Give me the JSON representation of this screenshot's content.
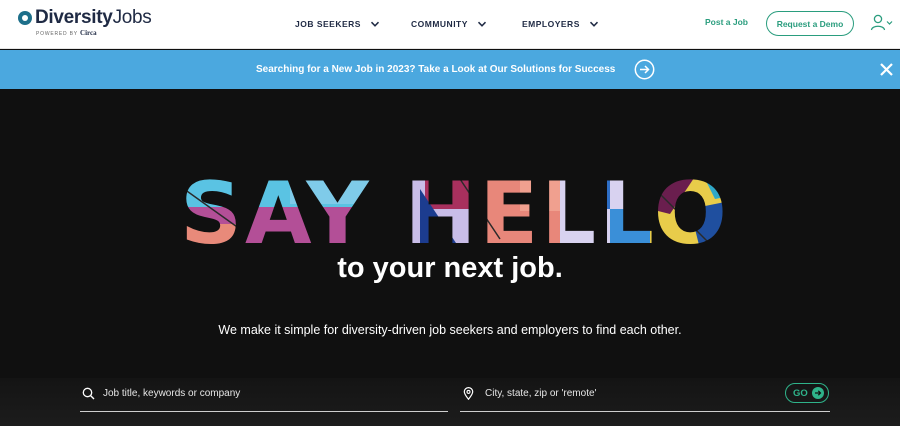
{
  "brand": {
    "name_bold": "Diversity",
    "name_light": "Jobs",
    "powered_by": "POWERED BY",
    "parent": "Circa"
  },
  "nav": {
    "items": [
      {
        "label": "JOB SEEKERS",
        "icon": "chevron-down-icon"
      },
      {
        "label": "COMMUNITY",
        "icon": "chevron-down-icon"
      },
      {
        "label": "EMPLOYERS",
        "icon": "chevron-down-icon"
      }
    ],
    "post_job": "Post a Job",
    "request_demo": "Request a Demo",
    "user_icon": "user-icon"
  },
  "banner": {
    "text": "Searching for a New Job in 2023? Take a Look at Our Solutions for Success",
    "arrow_icon": "arrow-right-circle-icon",
    "close_icon": "close-icon",
    "color": "#4ba8df"
  },
  "hero": {
    "headline": "SAY HELLO",
    "subheadline": "to your next job.",
    "tagline": "We make it simple for diversity-driven job seekers and employers to find each other."
  },
  "search": {
    "keyword_placeholder": "Job title, keywords or company",
    "keyword_value": "",
    "location_placeholder": "City, state, zip or 'remote'",
    "location_value": "",
    "go_label": "GO"
  },
  "colors": {
    "accent": "#2a9d7e",
    "navy": "#1f2a44",
    "hero_bg": "#101010"
  }
}
